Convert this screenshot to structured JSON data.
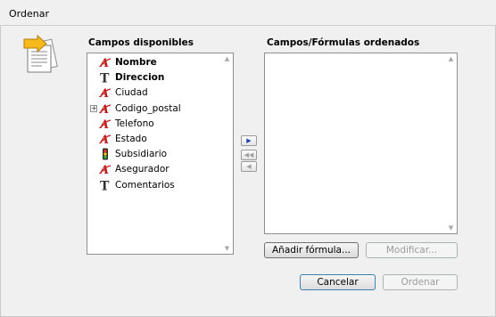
{
  "window": {
    "title": "Ordenar"
  },
  "available": {
    "label": "Campos disponibles",
    "fields": [
      {
        "name": "Nombre",
        "icon": "text-field-icon",
        "bold": true,
        "expandable": false
      },
      {
        "name": "Direccion",
        "icon": "memo-field-icon",
        "bold": true,
        "expandable": false
      },
      {
        "name": "Ciudad",
        "icon": "text-field-icon",
        "bold": false,
        "expandable": false
      },
      {
        "name": "Codigo_postal",
        "icon": "text-field-icon",
        "bold": false,
        "expandable": true
      },
      {
        "name": "Telefono",
        "icon": "text-field-icon",
        "bold": false,
        "expandable": false
      },
      {
        "name": "Estado",
        "icon": "text-field-icon",
        "bold": false,
        "expandable": false
      },
      {
        "name": "Subsidiario",
        "icon": "boolean-field-icon",
        "bold": false,
        "expandable": false
      },
      {
        "name": "Asegurador",
        "icon": "text-field-icon",
        "bold": false,
        "expandable": false
      },
      {
        "name": "Comentarios",
        "icon": "memo-field-icon",
        "bold": false,
        "expandable": false
      }
    ]
  },
  "sorted": {
    "label": "Campos/Fórmulas ordenados",
    "fields": []
  },
  "buttons": {
    "add_formula": "Añadir fórmula...",
    "modify": "Modificar...",
    "cancel": "Cancelar",
    "ok": "Ordenar"
  },
  "arrows": {
    "add": "▶",
    "remove_all": "◀◀",
    "remove": "◀"
  }
}
